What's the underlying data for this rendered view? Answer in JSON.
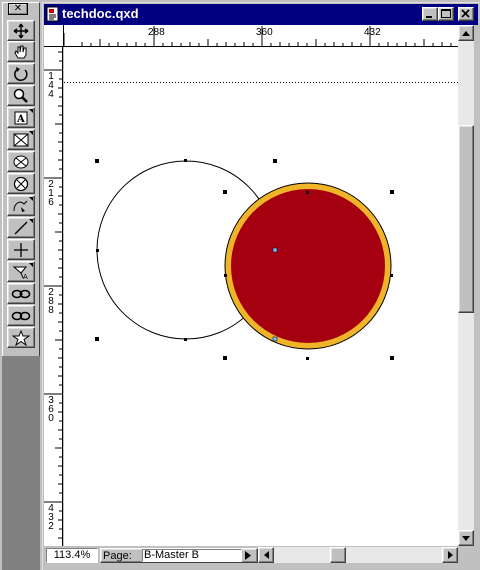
{
  "window": {
    "title": "techdoc.qxd"
  },
  "palette": {
    "close_glyph": "✕",
    "tools": [
      "item-tool-icon",
      "content-tool-icon",
      "rotation-tool-icon",
      "zoom-tool-icon",
      "text-box-tool-icon",
      "picture-box-tool-icon",
      "oval-picture-box-tool-icon",
      "circle-picture-box-tool-icon",
      "bezier-picture-box-tool-icon",
      "line-tool-icon",
      "orthogonal-line-tool-icon",
      "text-path-tool-icon",
      "linking-tool-icon",
      "unlinking-tool-icon",
      "star-tool-icon"
    ]
  },
  "ruler_h": {
    "labels": [
      "288",
      "360",
      "432"
    ]
  },
  "ruler_v": {
    "labels": [
      [
        "1",
        "4",
        "4"
      ],
      [
        "2",
        "1",
        "6"
      ],
      [
        "2",
        "8",
        "8"
      ],
      [
        "3",
        "6",
        "0"
      ],
      [
        "4",
        "3",
        "2"
      ]
    ]
  },
  "status": {
    "zoom": "113.4%",
    "page_label": "Page:",
    "page_value": "B-Master B"
  },
  "colors": {
    "titlebar": "#000080",
    "fill": "#a50010",
    "frame": "#f0b428",
    "handle_blue": "#7fb8ff"
  },
  "canvas": {
    "objects": [
      {
        "name": "empty-oval-picture-box",
        "fill": "none",
        "frame": "#000000"
      },
      {
        "name": "red-circle-picture-box",
        "fill": "#a50010",
        "frame": "#f0b428",
        "selected": true
      }
    ]
  }
}
